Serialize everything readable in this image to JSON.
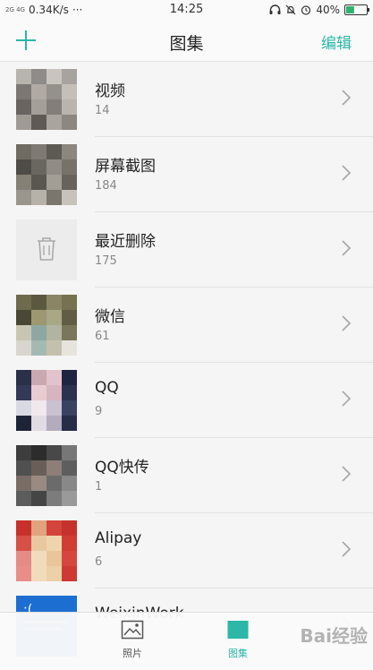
{
  "status_bar": {
    "network_label": "2G 4G",
    "speed": "0.34K/s",
    "dots": "···",
    "time": "14:25",
    "battery_percent": "40%",
    "battery_level": 0.4,
    "icons": [
      "headset-icon",
      "mute-bell-icon",
      "alarm-icon",
      "battery-icon"
    ]
  },
  "header": {
    "title": "图集",
    "edit_label": "编辑",
    "add_icon": "plus-icon",
    "accent_color": "#2cb7a7"
  },
  "albums": [
    {
      "name": "视频",
      "count": "14",
      "thumb": "video-thumb"
    },
    {
      "name": "屏幕截图",
      "count": "184",
      "thumb": "screenshot-thumb"
    },
    {
      "name": "最近删除",
      "count": "175",
      "thumb": "trash-icon"
    },
    {
      "name": "微信",
      "count": "61",
      "thumb": "wechat-thumb"
    },
    {
      "name": "QQ",
      "count": "9",
      "thumb": "qq-thumb"
    },
    {
      "name": "QQ快传",
      "count": "1",
      "thumb": "qq-transfer-thumb"
    },
    {
      "name": "Alipay",
      "count": "6",
      "thumb": "alipay-thumb"
    },
    {
      "name": "WeixinWork",
      "count": "",
      "thumb": "weixinwork-thumb"
    }
  ],
  "tabs": [
    {
      "label": "照片",
      "icon": "photo-icon",
      "selected": false
    },
    {
      "label": "图集",
      "icon": "album-icon",
      "selected": true
    }
  ],
  "watermark": "Bai经验"
}
